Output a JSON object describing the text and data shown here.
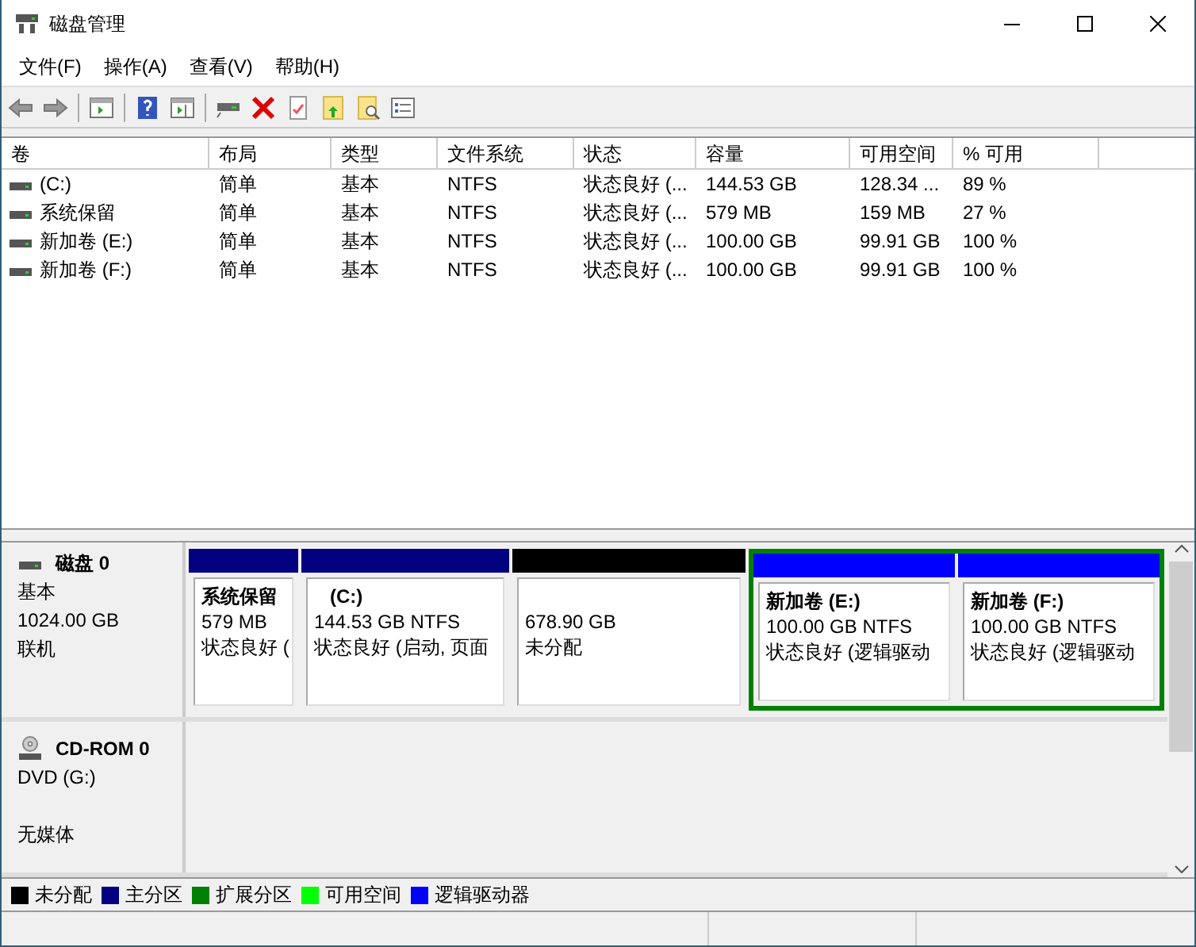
{
  "window": {
    "title": "磁盘管理"
  },
  "menu": [
    "文件(F)",
    "操作(A)",
    "查看(V)",
    "帮助(H)"
  ],
  "volumes": {
    "columns": [
      "卷",
      "布局",
      "类型",
      "文件系统",
      "状态",
      "容量",
      "可用空间",
      "% 可用"
    ],
    "rows": [
      [
        "(C:)",
        "简单",
        "基本",
        "NTFS",
        "状态良好 (...",
        "144.53 GB",
        "128.34 ...",
        "89 %"
      ],
      [
        "系统保留",
        "简单",
        "基本",
        "NTFS",
        "状态良好 (...",
        "579 MB",
        "159 MB",
        "27 %"
      ],
      [
        "新加卷 (E:)",
        "简单",
        "基本",
        "NTFS",
        "状态良好 (...",
        "100.00 GB",
        "99.91 GB",
        "100 %"
      ],
      [
        "新加卷 (F:)",
        "简单",
        "基本",
        "NTFS",
        "状态良好 (...",
        "100.00 GB",
        "99.91 GB",
        "100 %"
      ]
    ]
  },
  "disks": [
    {
      "kind": "disk",
      "name": "磁盘 0",
      "type": "基本",
      "size": "1024.00 GB",
      "status": "联机",
      "partitions": [
        {
          "kind": "primary",
          "color": "#000080",
          "label": "系统保留",
          "size": "579 MB",
          "status": "状态良好 ("
        },
        {
          "kind": "primary",
          "color": "#000080",
          "label": "(C:)",
          "size": "144.53 GB NTFS",
          "status": "状态良好 (启动, 页面"
        },
        {
          "kind": "unallocated",
          "color": "#000000",
          "size": "678.90 GB",
          "status": "未分配"
        },
        {
          "kind": "extended",
          "color": "#008000",
          "children": [
            {
              "kind": "logical",
              "color": "#0000ff",
              "label": "新加卷 (E:)",
              "size": "100.00 GB NTFS",
              "status": "状态良好 (逻辑驱动"
            },
            {
              "kind": "logical",
              "color": "#0000ff",
              "label": "新加卷 (F:)",
              "size": "100.00 GB NTFS",
              "status": "状态良好 (逻辑驱动"
            }
          ]
        }
      ]
    },
    {
      "kind": "cdrom",
      "name": "CD-ROM 0",
      "type": "DVD (G:)",
      "status": "无媒体"
    }
  ],
  "legend": [
    {
      "label": "未分配",
      "color": "#000000"
    },
    {
      "label": "主分区",
      "color": "#000080"
    },
    {
      "label": "扩展分区",
      "color": "#008000"
    },
    {
      "label": "可用空间",
      "color": "#00ff00"
    },
    {
      "label": "逻辑驱动器",
      "color": "#0000ff"
    }
  ]
}
